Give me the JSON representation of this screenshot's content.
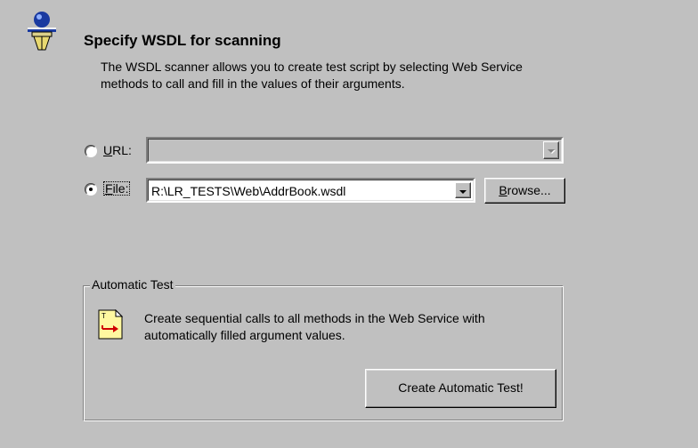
{
  "wizard": {
    "title": "Specify WSDL for scanning",
    "description": "The WSDL scanner allows you to create test script by selecting Web Service methods to call and fill in the values of their arguments.",
    "header_icon": "wizard-person-icon"
  },
  "source": {
    "url": {
      "label_accel": "U",
      "label_rest": "RL:",
      "value": "",
      "enabled": false,
      "selected": false
    },
    "file": {
      "label_accel": "F",
      "label_rest": "ile:",
      "value": "R:\\LR_TESTS\\Web\\AddrBook.wsdl",
      "enabled": true,
      "selected": true
    },
    "browse": {
      "label_accel": "B",
      "label_rest": "rowse..."
    }
  },
  "automatic_test": {
    "group_title": "Automatic Test",
    "icon": "document-arrow-icon",
    "description": "Create sequential calls to all methods in the Web Service with automatically filled argument values.",
    "button_label": "Create Automatic Test!"
  },
  "colors": {
    "face": "#c0c0c0",
    "shadow": "#808080",
    "highlight": "#ffffff",
    "window": "#ffffff"
  }
}
